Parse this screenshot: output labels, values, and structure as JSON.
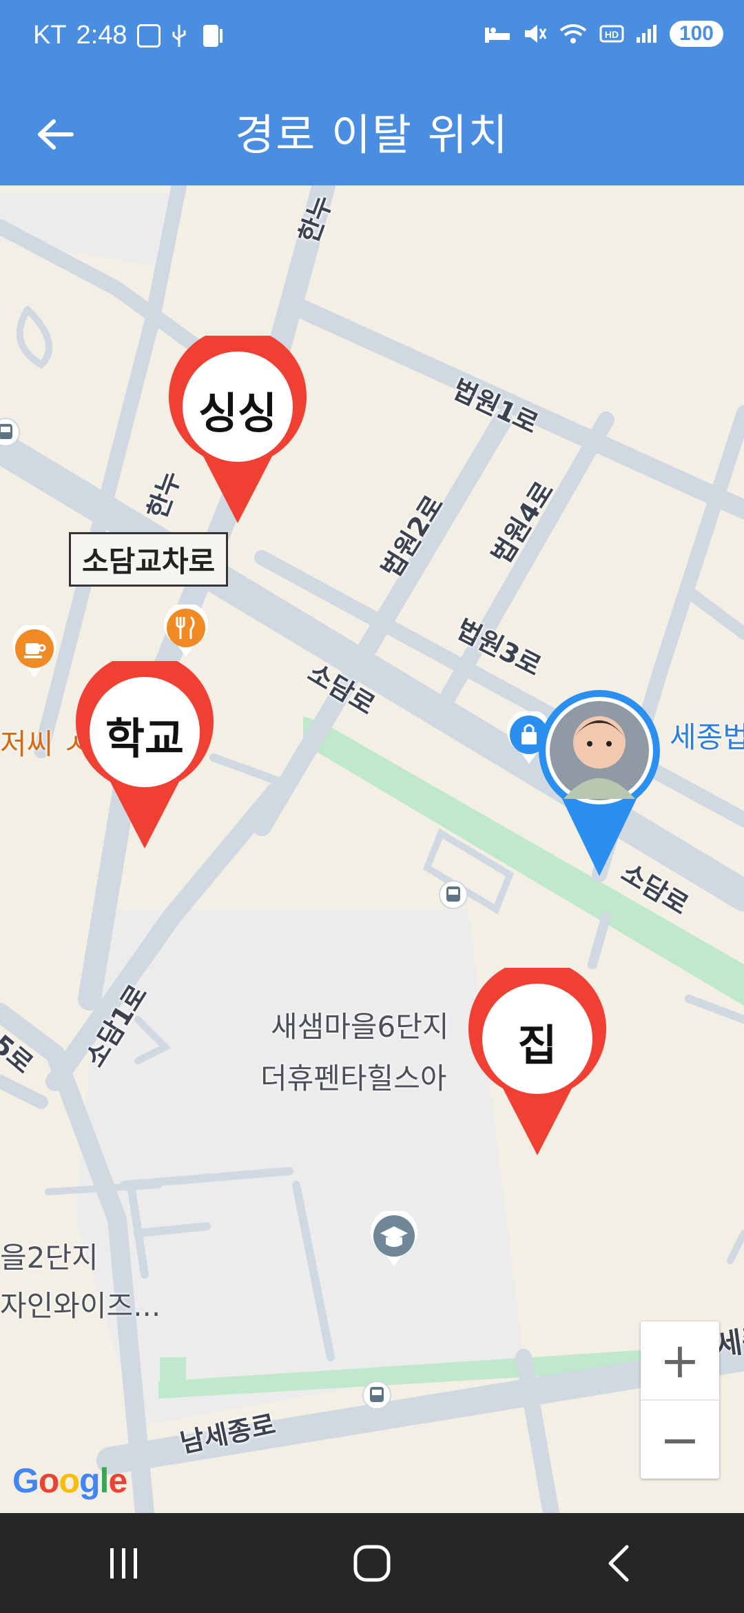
{
  "status_bar": {
    "carrier": "KT",
    "time": "2:48",
    "battery": "100",
    "left_icons": [
      "screenshot-icon",
      "usb-icon",
      "phone-icon"
    ],
    "right_icons": [
      "sleep-icon",
      "mute-icon",
      "wifi-icon",
      "hd-icon",
      "signal-icon"
    ]
  },
  "app_bar": {
    "title": "경로 이탈 위치",
    "back_icon": "arrow-back-icon"
  },
  "map": {
    "road_labels": [
      "법원1로",
      "법원2로",
      "법원4로",
      "법원3로",
      "소담로",
      "소담로",
      "소담1로",
      "남세종로",
      "한누",
      "한누",
      "5로"
    ],
    "boxed_label": "소담교차로",
    "place_labels": {
      "complex_1": "새샘마을6단지",
      "complex_2": "더휴펜타힐스아",
      "left_1": "을2단지",
      "left_2": "자인와이즈...",
      "sejong": "세종법",
      "cafe": "저씨 ㅅ",
      "right_edge": "남세종"
    },
    "pins": [
      {
        "label": "싱싱",
        "color": "#f04033"
      },
      {
        "label": "학교",
        "color": "#f04033"
      },
      {
        "label": "집",
        "color": "#f04033"
      }
    ],
    "current_location": {
      "color": "#2b8ff0",
      "avatar": "child-avatar"
    },
    "poi_icons": [
      "cafe-icon",
      "restaurant-icon",
      "shopping-icon",
      "school-icon",
      "bus-stop-icon",
      "bus-stop-icon",
      "bus-stop-icon"
    ],
    "zoom_in": "+",
    "zoom_out": "−",
    "logo": "Google"
  },
  "nav_bar": {
    "buttons": [
      "recent-apps-icon",
      "home-icon",
      "back-icon"
    ]
  }
}
